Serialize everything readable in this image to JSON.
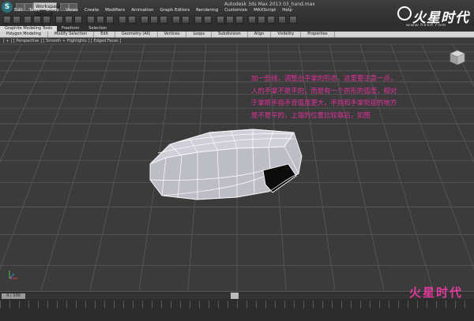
{
  "window": {
    "title": "Autodesk 3ds Max 2013    03_hand.max",
    "logo_letter": "S",
    "workspace": "Workspace: Default"
  },
  "menu": [
    "Edit",
    "Tools",
    "Group",
    "Views",
    "Create",
    "Modifiers",
    "Animation",
    "Graph Editors",
    "Rendering",
    "Customize",
    "MAXScript",
    "Help"
  ],
  "ribbon": {
    "tabs": [
      "Graphite Modeling Tools",
      "Freeform",
      "Selection"
    ],
    "active_tab": "Graphite Modeling Tools"
  },
  "subribbon": [
    "Polygon Modeling",
    "Modify Selection",
    "Edit",
    "Geometry (All)",
    "Vertices",
    "Loops",
    "Subdivision",
    "Align",
    "Visibility",
    "Properties"
  ],
  "viewport": {
    "label": "[ + ] [ Perspective ] [ Smooth + Highlights ] [ Edged Faces ]",
    "annotation": [
      "加一些线，调整出手掌的形态，这里要注意一点，",
      "人的手掌不是平的，而是有一个拱形的弧度，相对",
      "于掌根手指手背弧度更大，手指和手掌衔接的地方",
      "是不是平的，上端的位置比较靠后，如图"
    ]
  },
  "timeline": {
    "frame_label": "0 / 100"
  },
  "brand": {
    "name": "火星时代",
    "url": "www.hxsd.com"
  },
  "watermark": "火星时代",
  "colors": {
    "annotation": "#e0309a",
    "viewport_bg": "#3b3b3b"
  }
}
